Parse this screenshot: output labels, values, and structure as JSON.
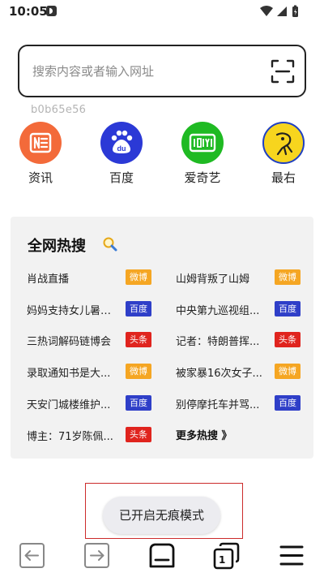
{
  "status_bar": {
    "time": "10:05"
  },
  "search": {
    "placeholder": "搜索内容或者输入网址"
  },
  "user_id": "b0b65e56",
  "shortcuts": [
    {
      "label": "资讯",
      "icon": "news-icon",
      "color": "#f36a3a"
    },
    {
      "label": "百度",
      "icon": "baidu-paw-icon",
      "color": "#2b39d6"
    },
    {
      "label": "爱奇艺",
      "icon": "iqiyi-icon",
      "color": "#1fba23"
    },
    {
      "label": "最右",
      "icon": "zuiyou-icon",
      "color": "#f7d51e"
    }
  ],
  "hot_search": {
    "title": "全网热搜",
    "items": [
      {
        "text": "肖战直播",
        "tag": "微博",
        "tag_color": "#f5a623"
      },
      {
        "text": "山姆背叛了山姆",
        "tag": "微博",
        "tag_color": "#f5a623"
      },
      {
        "text": "妈妈支持女儿暑假...",
        "tag": "百度",
        "tag_color": "#2f3fc8"
      },
      {
        "text": "中央第九巡视组...",
        "tag": "百度",
        "tag_color": "#2f3fc8"
      },
      {
        "text": "三热词解码链博会",
        "tag": "头条",
        "tag_color": "#e0241e"
      },
      {
        "text": "记者：特朗普挥...",
        "tag": "头条",
        "tag_color": "#e0241e"
      },
      {
        "text": "录取通知书是大...",
        "tag": "微博",
        "tag_color": "#f5a623"
      },
      {
        "text": "被家暴16次女子...",
        "tag": "微博",
        "tag_color": "#f5a623"
      },
      {
        "text": "天安门城楼维护...",
        "tag": "百度",
        "tag_color": "#2f3fc8"
      },
      {
        "text": "别停摩托车并骂...",
        "tag": "百度",
        "tag_color": "#2f3fc8"
      },
      {
        "text": "博主：71岁陈佩...",
        "tag": "头条",
        "tag_color": "#e0241e"
      }
    ],
    "more_label": "更多热搜 》"
  },
  "toast": {
    "text": "已开启无痕模式"
  },
  "bottom_nav": {
    "tab_count": "1"
  }
}
